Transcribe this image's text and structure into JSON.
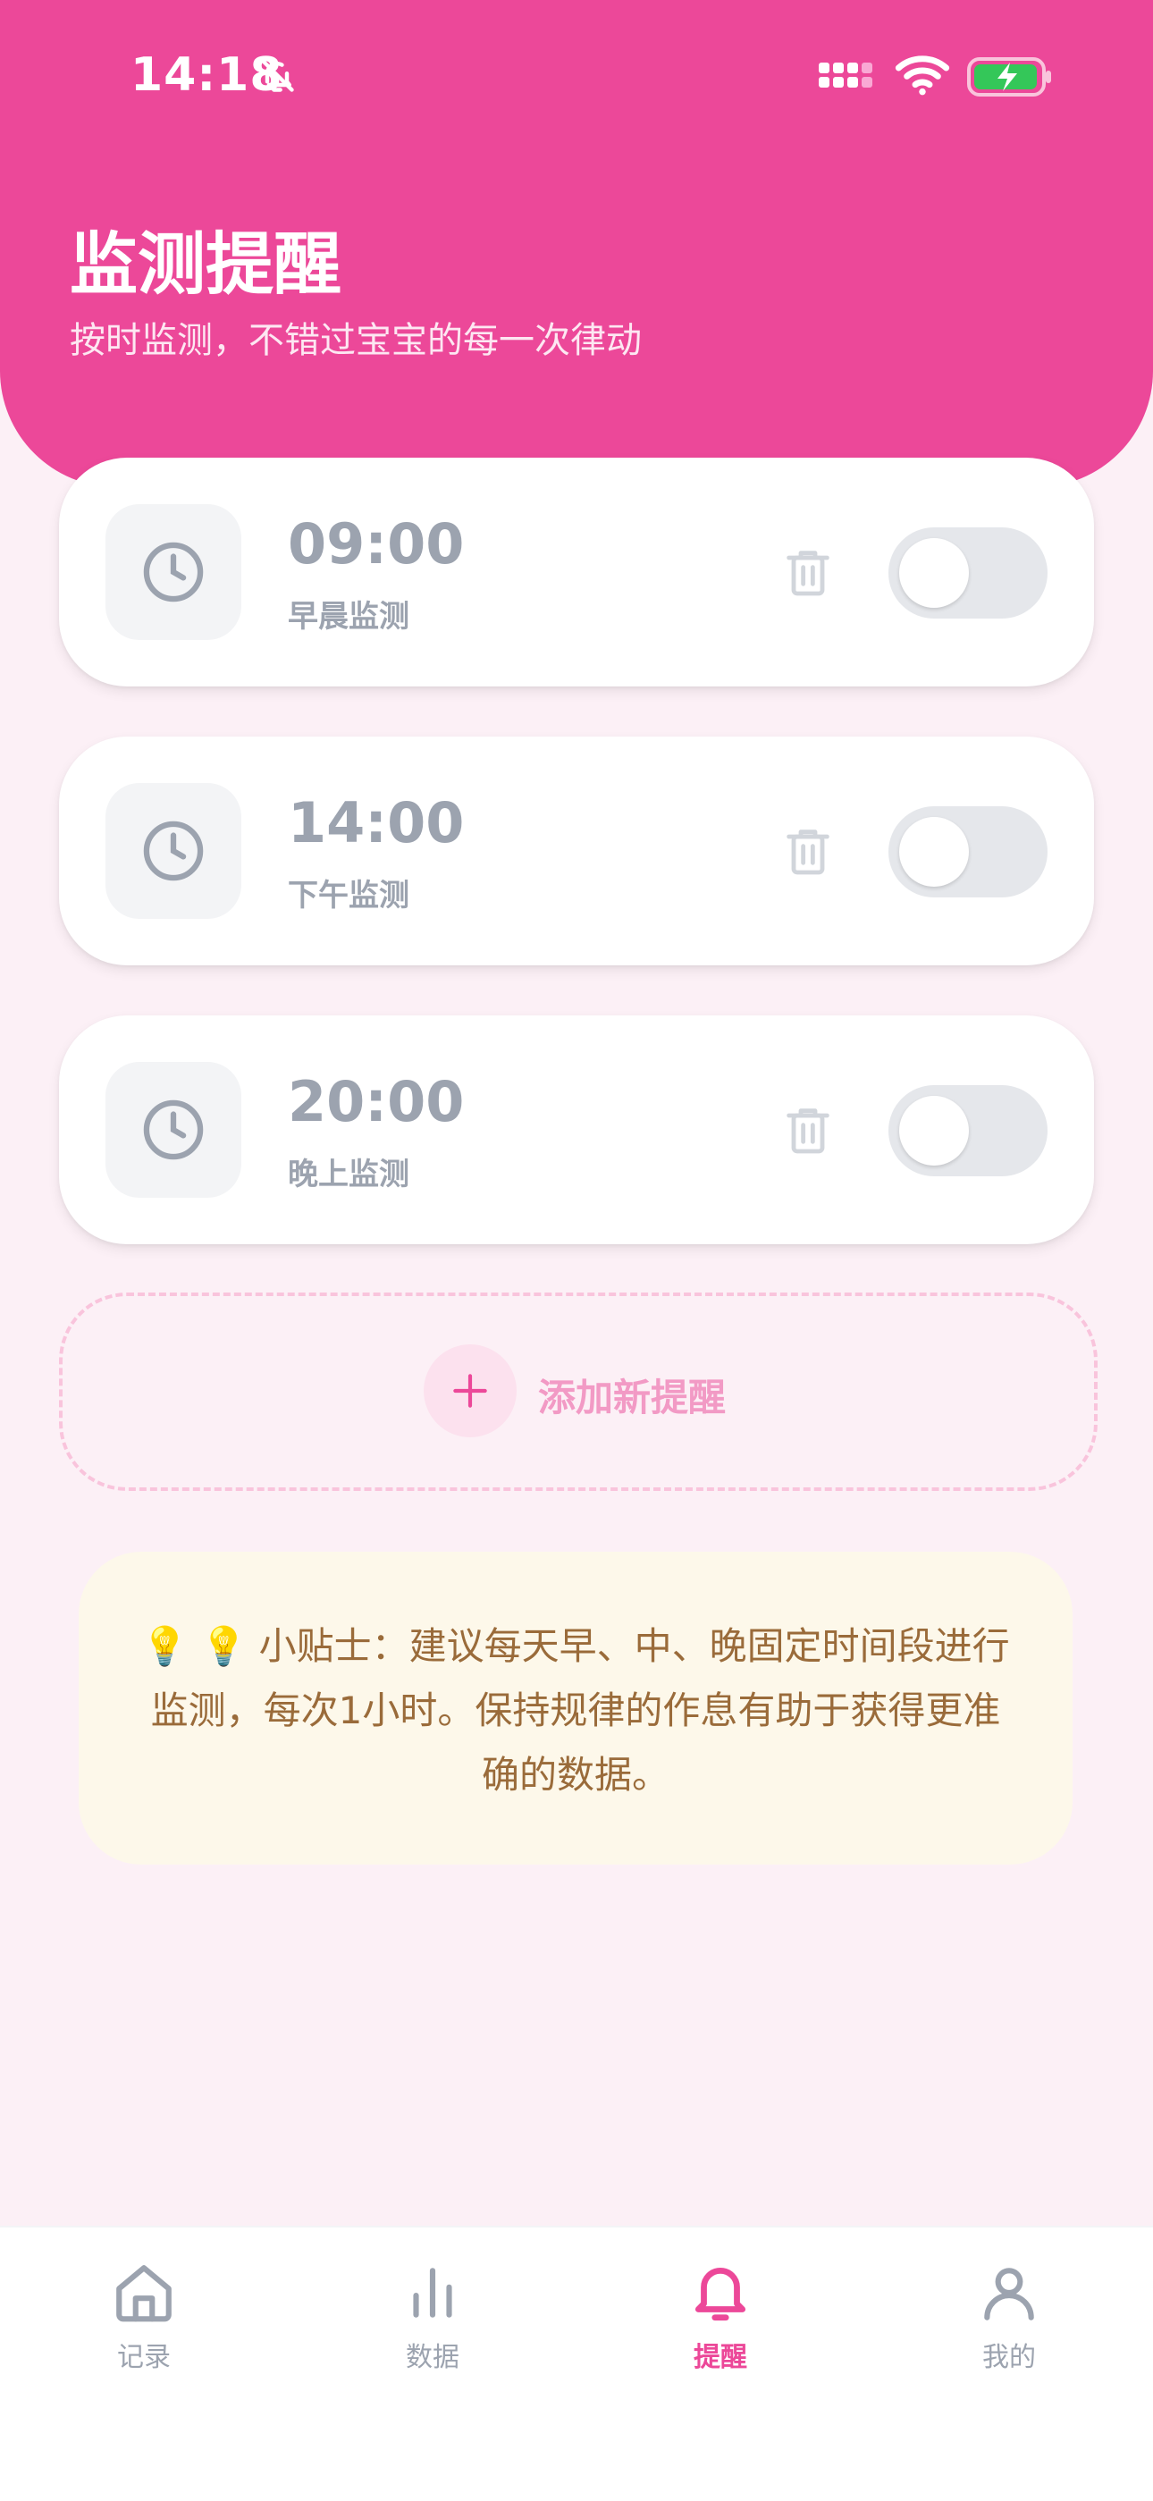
{
  "status_bar": {
    "time": "14:18"
  },
  "header": {
    "title": "监测提醒",
    "subtitle": "按时监测，不错过宝宝的每一次律动"
  },
  "reminders": [
    {
      "time": "09:00",
      "label": "早晨监测",
      "enabled": false
    },
    {
      "time": "14:00",
      "label": "下午监测",
      "enabled": false
    },
    {
      "time": "20:00",
      "label": "晚上监测",
      "enabled": false
    }
  ],
  "add_button": {
    "label": "添加新提醒"
  },
  "tip": {
    "text": "💡 💡 小贴士：建议每天早、中、晚固定时间段进行监测，每次1小时。保持规律的作息有助于获得更准确的数据。"
  },
  "tabbar": {
    "items": [
      {
        "label": "记录",
        "icon": "home-icon"
      },
      {
        "label": "数据",
        "icon": "bar-chart-icon"
      },
      {
        "label": "提醒",
        "icon": "bell-icon",
        "active": true
      },
      {
        "label": "我的",
        "icon": "user-icon"
      }
    ]
  },
  "colors": {
    "primary": "#ec4899",
    "background": "#fcf0f6",
    "muted": "#9ca3af",
    "tip_text": "#9a6b3a",
    "tip_background": "#fdf8ea"
  }
}
